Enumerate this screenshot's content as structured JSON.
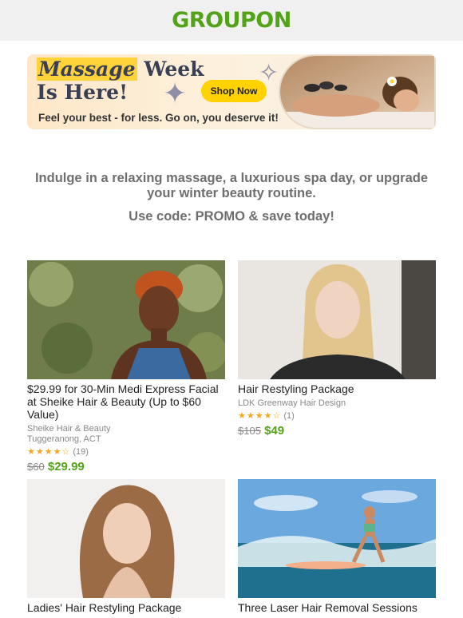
{
  "header": {
    "logo": "GROUPON"
  },
  "banner": {
    "title_highlight": "Massage",
    "title_rest": " Week",
    "title_line2": "Is Here!",
    "subtitle": "Feel your best - for less. Go on, you deserve it!",
    "cta": "Shop Now"
  },
  "intro": {
    "text": "Indulge in a relaxing massage, a luxurious spa day, or upgrade your winter beauty routine.",
    "promo": "Use code: PROMO & save today!"
  },
  "deals": [
    {
      "title": "$29.99 for 30-Min Medi Express Facial at Sheike Hair & Beauty (Up to $60 Value)",
      "merchant": "Sheike Hair & Beauty",
      "location": "Tuggeranong, ACT",
      "stars": "★★★★☆",
      "rating_count": "(19)",
      "old_price": "$60",
      "new_price": "$29.99"
    },
    {
      "title": "Hair Restyling Package",
      "merchant": "LDK Greenway Hair Design",
      "stars": "★★★★☆",
      "rating_count": "(1)",
      "old_price": "$105",
      "new_price": "$49"
    },
    {
      "title": "Ladies' Hair Restyling Package"
    },
    {
      "title": "Three Laser Hair Removal Sessions"
    }
  ]
}
